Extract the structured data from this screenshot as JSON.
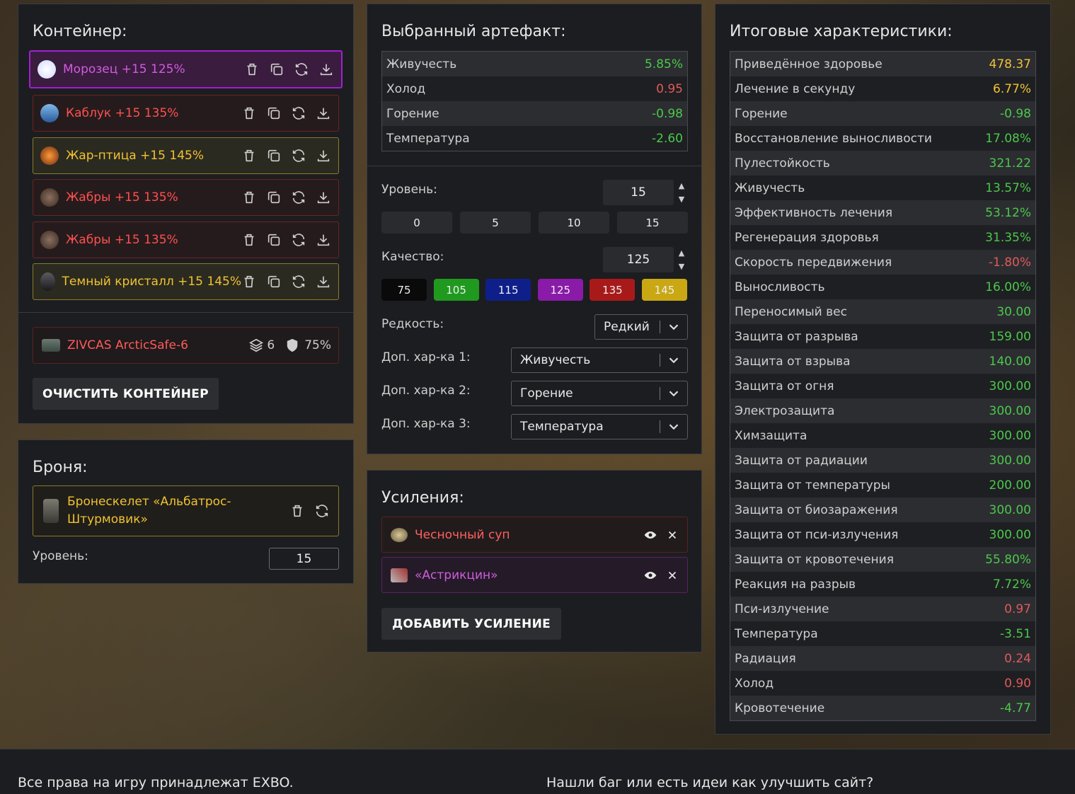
{
  "container": {
    "title": "Контейнер:",
    "artifacts": [
      {
        "name": "Морозец +15 125%",
        "color": "#d05ce0",
        "border": "#a020d0",
        "bg": "#3a1c3e",
        "thumb": "snow-orb-icon"
      },
      {
        "name": "Каблук +15 135%",
        "color": "#ff5050",
        "border": "#6a2424",
        "bg": "#261b1c",
        "thumb": "heel-artifact-icon"
      },
      {
        "name": "Жар-птица +15 145%",
        "color": "#f1c232",
        "border": "#8a7a28",
        "bg": "#2b2a20",
        "thumb": "firebird-artifact-icon"
      },
      {
        "name": "Жабры +15 135%",
        "color": "#ff5050",
        "border": "#6a2424",
        "bg": "#261b1c",
        "thumb": "gills-artifact-icon"
      },
      {
        "name": "Жабры +15 135%",
        "color": "#ff5050",
        "border": "#6a2424",
        "bg": "#261b1c",
        "thumb": "gills-artifact-icon"
      },
      {
        "name": "Темный кристалл +15 145%",
        "color": "#f1c232",
        "border": "#8a7a28",
        "bg": "#2b2a20",
        "thumb": "dark-crystal-icon"
      }
    ],
    "case": {
      "name": "ZIVCAS ArcticSafe-6",
      "slots": "6",
      "protection": "75%"
    },
    "clear_button": "ОЧИСТИТЬ КОНТЕЙНЕР"
  },
  "armor": {
    "title": "Броня:",
    "name": "Бронескелет «Альбатрос-Штурмовик»",
    "level_label": "Уровень:",
    "level": "15"
  },
  "selected": {
    "title": "Выбранный артефакт:",
    "stats": [
      {
        "label": "Живучесть",
        "value": "5.85%",
        "color": "green"
      },
      {
        "label": "Холод",
        "value": "0.95",
        "color": "red"
      },
      {
        "label": "Горение",
        "value": "-0.98",
        "color": "green"
      },
      {
        "label": "Температура",
        "value": "-2.60",
        "color": "green"
      }
    ],
    "level_label": "Уровень:",
    "level": "15",
    "level_presets": [
      "0",
      "5",
      "10",
      "15"
    ],
    "quality_label": "Качество:",
    "quality": "125",
    "quality_presets": [
      {
        "v": "75",
        "bg": "#0a0a0a"
      },
      {
        "v": "105",
        "bg": "#1f9a1f"
      },
      {
        "v": "115",
        "bg": "#0f1f8a"
      },
      {
        "v": "125",
        "bg": "#8a1aa8"
      },
      {
        "v": "135",
        "bg": "#a81a1a"
      },
      {
        "v": "145",
        "bg": "#c9a814"
      }
    ],
    "rarity_label": "Редкость:",
    "rarity": "Редкий",
    "extra1_label": "Доп. хар-ка 1:",
    "extra1": "Живучесть",
    "extra2_label": "Доп. хар-ка 2:",
    "extra2": "Горение",
    "extra3_label": "Доп. хар-ка 3:",
    "extra3": "Температура"
  },
  "boosts": {
    "title": "Усиления:",
    "items": [
      {
        "name": "Чесночный суп",
        "color": "#ff6060",
        "border": "#5a2222",
        "bg": "#211b1c"
      },
      {
        "name": "«Астрикцин»",
        "color": "#d05ce0",
        "border": "#5a2266",
        "bg": "#251b28"
      }
    ],
    "add_button": "ДОБАВИТЬ УСИЛЕНИЕ"
  },
  "totals": {
    "title": "Итоговые характеристики:",
    "stats": [
      {
        "label": "Приведённое здоровье",
        "value": "478.37",
        "color": "yellow"
      },
      {
        "label": "Лечение в секунду",
        "value": "6.77%",
        "color": "yellow"
      },
      {
        "label": "Горение",
        "value": "-0.98",
        "color": "green"
      },
      {
        "label": "Восстановление выносливости",
        "value": "17.08%",
        "color": "green"
      },
      {
        "label": "Пулестойкость",
        "value": "321.22",
        "color": "green"
      },
      {
        "label": "Живучесть",
        "value": "13.57%",
        "color": "green"
      },
      {
        "label": "Эффективность лечения",
        "value": "53.12%",
        "color": "green"
      },
      {
        "label": "Регенерация здоровья",
        "value": "31.35%",
        "color": "green"
      },
      {
        "label": "Скорость передвижения",
        "value": "-1.80%",
        "color": "red"
      },
      {
        "label": "Выносливость",
        "value": "16.00%",
        "color": "green"
      },
      {
        "label": "Переносимый вес",
        "value": "30.00",
        "color": "green"
      },
      {
        "label": "Защита от разрыва",
        "value": "159.00",
        "color": "green"
      },
      {
        "label": "Защита от взрыва",
        "value": "140.00",
        "color": "green"
      },
      {
        "label": "Защита от огня",
        "value": "300.00",
        "color": "green"
      },
      {
        "label": "Электрозащита",
        "value": "300.00",
        "color": "green"
      },
      {
        "label": "Химзащита",
        "value": "300.00",
        "color": "green"
      },
      {
        "label": "Защита от радиации",
        "value": "300.00",
        "color": "green"
      },
      {
        "label": "Защита от температуры",
        "value": "200.00",
        "color": "green"
      },
      {
        "label": "Защита от биозаражения",
        "value": "300.00",
        "color": "green"
      },
      {
        "label": "Защита от пси-излучения",
        "value": "300.00",
        "color": "green"
      },
      {
        "label": "Защита от кровотечения",
        "value": "55.80%",
        "color": "green"
      },
      {
        "label": "Реакция на разрыв",
        "value": "7.72%",
        "color": "green"
      },
      {
        "label": "Пси-излучение",
        "value": "0.97",
        "color": "red"
      },
      {
        "label": "Температура",
        "value": "-3.51",
        "color": "green"
      },
      {
        "label": "Радиация",
        "value": "0.24",
        "color": "red"
      },
      {
        "label": "Холод",
        "value": "0.90",
        "color": "red"
      },
      {
        "label": "Кровотечение",
        "value": "-4.77",
        "color": "green"
      }
    ]
  },
  "footer": {
    "rights": "Все права на игру принадлежат EXBO.",
    "feedback": "Нашли баг или есть идеи как улучшить сайт?"
  }
}
